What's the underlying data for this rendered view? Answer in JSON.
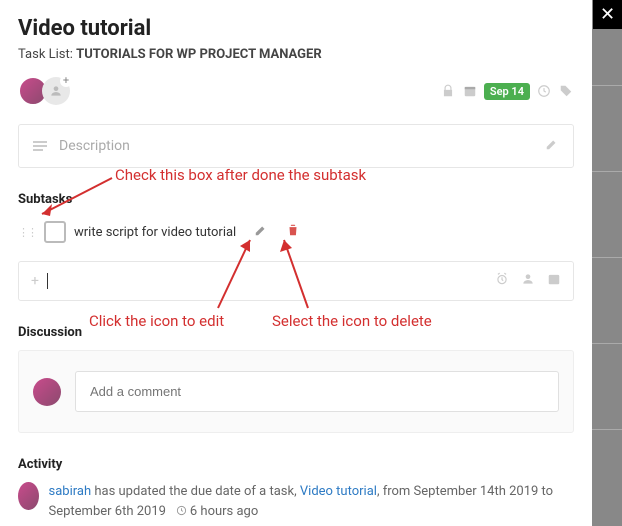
{
  "header": {
    "title": "Video tutorial",
    "tasklist_prefix": "Task List:",
    "tasklist_name": "TUTORIALS FOR WP PROJECT MANAGER",
    "due_date": "Sep 14"
  },
  "description": {
    "placeholder": "Description"
  },
  "subtasks": {
    "heading": "Subtasks",
    "items": [
      {
        "label": "write script for video tutorial",
        "done": false
      }
    ],
    "add_placeholder": ""
  },
  "discussion": {
    "heading": "Discussion",
    "comment_placeholder": "Add a comment"
  },
  "activity": {
    "heading": "Activity",
    "items": [
      {
        "user": "sabirah",
        "text_before": " has updated the due date of a task, ",
        "task": "Video tutorial",
        "text_after": ", from September 14th 2019 to September 6th 2019",
        "ago": "6 hours ago"
      }
    ]
  },
  "annotations": {
    "check": "Check this box after done the subtask",
    "edit": "Click the icon to edit",
    "delete": "Select the icon to delete"
  }
}
